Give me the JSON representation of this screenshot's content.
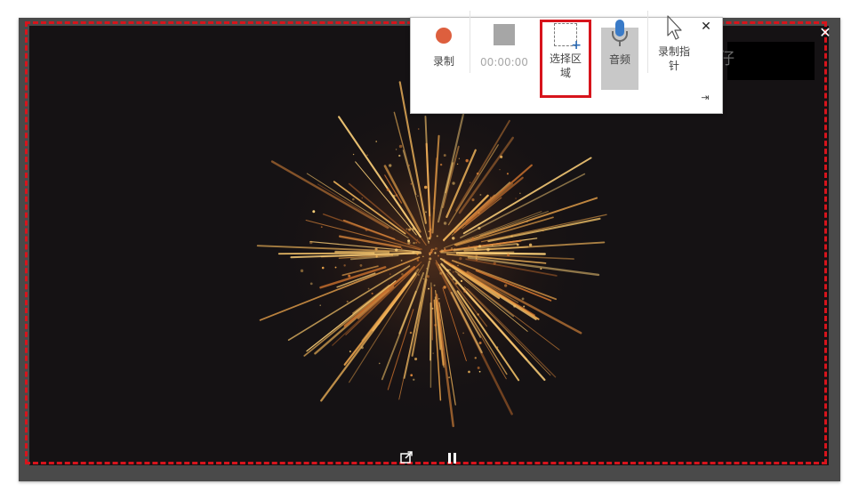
{
  "toolbar": {
    "record_label": "录制",
    "timer": "00:00:00",
    "select_area_label_line1": "选择区",
    "select_area_label_line2": "域",
    "audio_label": "音频",
    "record_pointer_label_line1": "录制指",
    "record_pointer_label_line2": "针",
    "close_glyph": "✕",
    "pin_glyph": "⇥"
  },
  "overlay": {
    "close_glyph": "✕",
    "partial_glyph": "仔"
  },
  "icons": {
    "record": "record-icon",
    "stop": "stop-icon",
    "select_area": "select-area-icon",
    "microphone": "microphone-icon",
    "pointer": "pointer-icon",
    "popout": "popout-icon",
    "pause": "pause-icon"
  },
  "colors": {
    "selection_dash": "#d7141c",
    "highlight": "#d7141c",
    "record_dot": "#dd5f3e",
    "mic_blue": "#3a7bc8",
    "video_bg": "#151214"
  }
}
